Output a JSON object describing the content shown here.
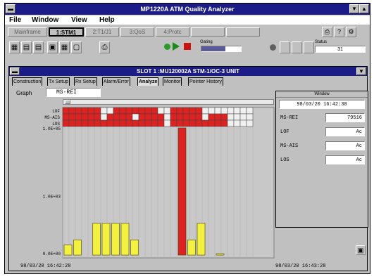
{
  "window": {
    "title": "MP1220A ATM Quality Analyzer",
    "menus": [
      "File",
      "Window",
      "View",
      "Help"
    ]
  },
  "tabs_top": [
    {
      "label": "Mainframe",
      "active": false
    },
    {
      "label": "1:STM1",
      "active": true
    },
    {
      "label": "2:T1/J1",
      "active": false
    },
    {
      "label": "3:QoS",
      "active": false
    },
    {
      "label": "4:Protc",
      "active": false
    }
  ],
  "toolbar": {
    "icons": [
      "table-icon",
      "list-icon",
      "document-icon",
      "chart-icon",
      "grid-icon",
      "printer-icon"
    ],
    "status_label": "Status",
    "gating_label": "Gating",
    "gating_value": "31"
  },
  "child": {
    "title": "SLOT 1 :MU120002A STM-1/OC-3 UNIT",
    "tabs": [
      {
        "label": "Construction",
        "active": false
      },
      {
        "label": "Tx Setup",
        "active": false
      },
      {
        "label": "Rx Setup",
        "active": false
      },
      {
        "label": "Alarm/Error",
        "active": false
      },
      {
        "label": "Analyze",
        "active": true
      },
      {
        "label": "Monitor",
        "active": false
      },
      {
        "label": "Pointer History",
        "active": false
      }
    ],
    "graph_label": "Graph",
    "graph_value": "MS-REI"
  },
  "info": {
    "header": "Window",
    "timestamp": "98/03/20 16:42:38",
    "rows": [
      {
        "label": "MS-REI",
        "value": "79516"
      },
      {
        "label": "LOF",
        "value": "Ac"
      },
      {
        "label": "MS-AIS",
        "value": "Ac"
      },
      {
        "label": "LOS",
        "value": "Ac"
      }
    ]
  },
  "axis": {
    "start_time": "98/03/20 16:42:28",
    "end_time": "98/03/20 16:43:28"
  },
  "chart_data": {
    "type": "bar",
    "ylabels": [
      "1.0E+05",
      "1.0E+03",
      "0.0E+00"
    ],
    "alarm_rows": [
      "LOF",
      "MS-AIS",
      "LOS"
    ],
    "alarm_grid": [
      [
        1,
        1,
        1,
        1,
        1,
        1,
        0,
        0,
        1,
        1,
        1,
        1,
        1,
        1,
        1,
        0,
        0,
        1,
        1,
        1,
        1,
        1,
        0,
        0,
        0,
        0,
        0,
        0,
        0,
        0
      ],
      [
        1,
        1,
        1,
        1,
        1,
        1,
        0,
        1,
        1,
        1,
        1,
        0,
        1,
        1,
        1,
        1,
        0,
        1,
        1,
        1,
        1,
        1,
        0,
        1,
        1,
        1,
        0,
        0,
        0,
        0
      ],
      [
        1,
        1,
        1,
        1,
        1,
        1,
        1,
        1,
        1,
        1,
        1,
        1,
        1,
        1,
        1,
        1,
        0,
        1,
        1,
        1,
        1,
        1,
        1,
        1,
        1,
        1,
        0,
        0,
        0,
        0
      ]
    ],
    "bars": [
      {
        "value": 0.08,
        "color": "yellow"
      },
      {
        "value": 0.12,
        "color": "yellow"
      },
      {
        "value": 0.0,
        "color": "yellow"
      },
      {
        "value": 0.25,
        "color": "yellow"
      },
      {
        "value": 0.25,
        "color": "yellow"
      },
      {
        "value": 0.25,
        "color": "yellow"
      },
      {
        "value": 0.25,
        "color": "yellow"
      },
      {
        "value": 0.12,
        "color": "yellow"
      },
      {
        "value": 0.0,
        "color": "none"
      },
      {
        "value": 0.0,
        "color": "none"
      },
      {
        "value": 0.0,
        "color": "none"
      },
      {
        "value": 0.0,
        "color": "none"
      },
      {
        "value": 1.0,
        "color": "red"
      },
      {
        "value": 0.12,
        "color": "yellow"
      },
      {
        "value": 0.25,
        "color": "yellow"
      },
      {
        "value": 0.0,
        "color": "none"
      },
      {
        "value": 0.01,
        "color": "yellow"
      }
    ]
  }
}
